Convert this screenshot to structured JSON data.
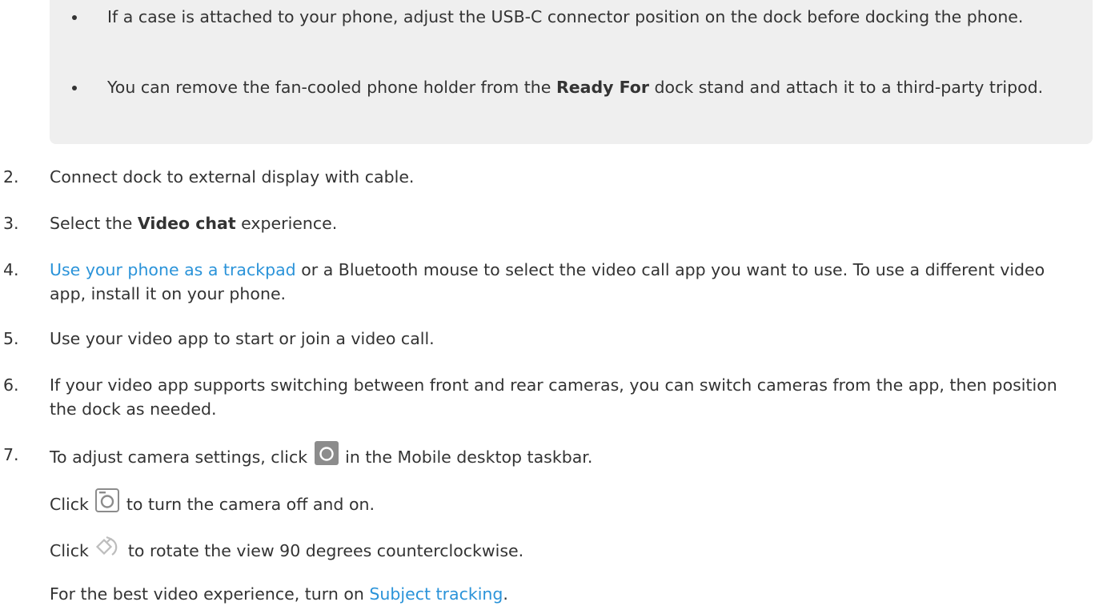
{
  "note": {
    "items": [
      {
        "text": "If a case is attached to your phone, adjust the USB-C connector position on the dock before docking the phone."
      },
      {
        "pre": "You can remove the fan-cooled phone holder from the ",
        "bold": "Ready For",
        "post": " dock stand and attach it to a third-party tripod."
      }
    ]
  },
  "steps": [
    {
      "num": "2.",
      "text": "Connect dock to external display with cable."
    },
    {
      "num": "3.",
      "pre": "Select the ",
      "bold": "Video chat",
      "post": " experience."
    },
    {
      "num": "4.",
      "link": "Use your phone as a trackpad",
      "post": " or a Bluetooth mouse to select the video call app you want to use. To use a different video app, install it on your phone."
    },
    {
      "num": "5.",
      "text": "Use your video app to start or join a video call."
    },
    {
      "num": "6.",
      "text": "If your video app supports switching between front and rear cameras, you can switch cameras from the app, then position the dock as needed."
    },
    {
      "num": "7.",
      "pre": "To adjust camera settings, click ",
      "post": " in the Mobile desktop taskbar."
    }
  ],
  "sub": {
    "camera_toggle": {
      "pre": "Click ",
      "post": " to turn the camera off and on."
    },
    "rotate": {
      "pre": "Click ",
      "post": " to rotate the view 90 degrees counterclockwise."
    },
    "tracking": {
      "pre": "For the best video experience, turn on ",
      "link": "Subject tracking",
      "post": "."
    }
  },
  "icons": {
    "taskbar_camera": "camera-filled-icon",
    "camera_toggle": "camera-outline-icon",
    "rotate": "rotate-icon"
  },
  "colors": {
    "link": "#2a93d9",
    "note_background": "#efefef",
    "text": "#333333"
  }
}
